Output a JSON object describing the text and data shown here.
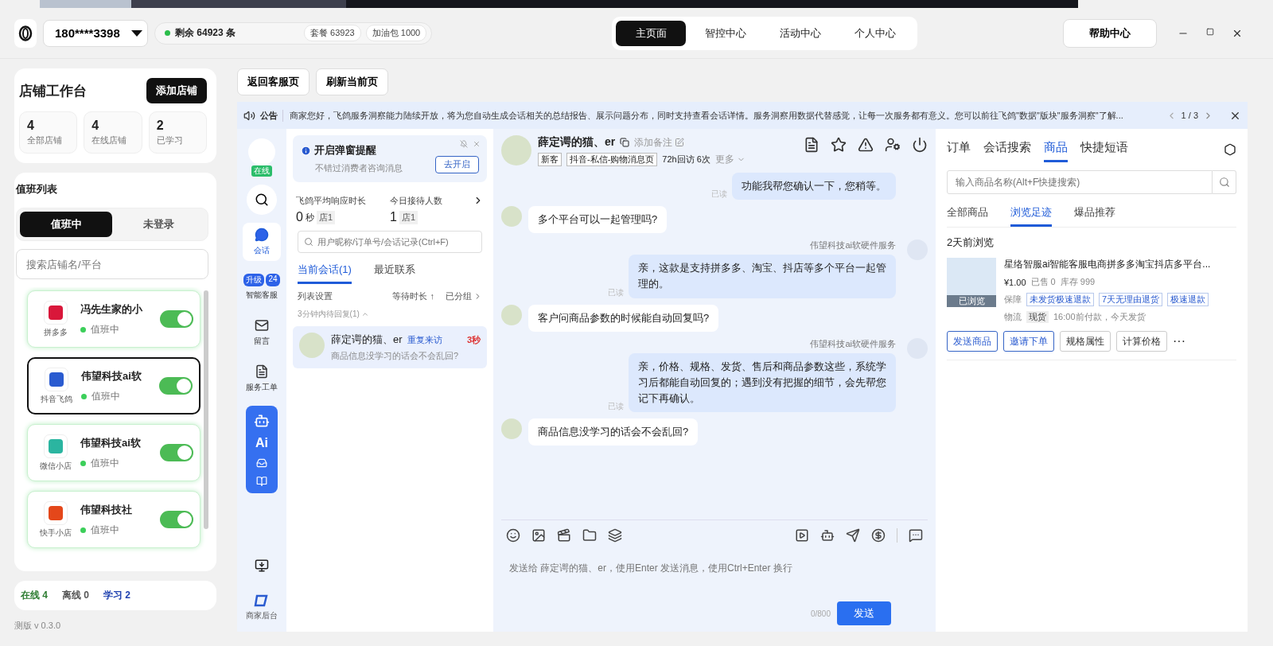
{
  "top_bar": {
    "account": "180****3398",
    "remaining": "剩余 64923 条",
    "package": "套餐 63923",
    "addon": "加油包 1000",
    "nav": [
      {
        "label": "主页面",
        "selected": true
      },
      {
        "label": "智控中心",
        "selected": false
      },
      {
        "label": "活动中心",
        "selected": false
      },
      {
        "label": "个人中心",
        "selected": false
      }
    ],
    "help": "帮助中心"
  },
  "sidebar": {
    "title": "店铺工作台",
    "add_button": "添加店铺",
    "stats": [
      {
        "value": "4",
        "label": "全部店铺"
      },
      {
        "value": "4",
        "label": "在线店铺"
      },
      {
        "value": "2",
        "label": "已学习"
      }
    ],
    "duty_title": "值班列表",
    "segments": [
      {
        "label": "值班中",
        "selected": true
      },
      {
        "label": "未登录",
        "selected": false
      }
    ],
    "search_placeholder": "搜索店铺名/平台",
    "shops": [
      {
        "name": "冯先生家的小",
        "platform": "拼多多",
        "kind": "pdd",
        "status": "值班中",
        "on": true,
        "selected": false
      },
      {
        "name": "伟望科技ai软",
        "platform": "抖音飞鸽",
        "kind": "douyin",
        "status": "值班中",
        "on": true,
        "selected": true
      },
      {
        "name": "伟望科技ai软",
        "platform": "微信小店",
        "kind": "wechat",
        "status": "值班中",
        "on": true,
        "selected": false
      },
      {
        "name": "伟望科技社",
        "platform": "快手小店",
        "kind": "kuaishou",
        "status": "值班中",
        "on": true,
        "selected": false
      }
    ],
    "footer": [
      {
        "label": "在线 4",
        "color": "#2e7d32"
      },
      {
        "label": "离线 0",
        "color": "#555555"
      },
      {
        "label": "学习 2",
        "color": "#1e40af"
      }
    ],
    "version": "测版 v 0.3.0"
  },
  "toolbar": [
    "返回客服页",
    "刷新当前页"
  ],
  "notice": {
    "label": "公告",
    "text": "商家您好，飞鸽服务洞察能力陆续开放，将为您自动生成会话相关的总结报告、展示问题分布，同时支持查看会话详情。服务洞察用数据代替感觉，让每一次服务都有意义。您可以前往飞鸽\"数据\"版块\"服务洞察\"了解...",
    "pager": "1 / 3"
  },
  "rail": {
    "status": "在线",
    "ai_label": "Ai",
    "items": [
      {
        "label": "会话",
        "kind": "chat",
        "selected": true
      },
      {
        "label": "智能客服",
        "kind": "bot",
        "selected": false,
        "badges": [
          "升级",
          "24"
        ]
      },
      {
        "label": "留言",
        "kind": "mail",
        "selected": false
      },
      {
        "label": "服务工单",
        "kind": "ticket",
        "selected": false
      }
    ],
    "bottom": "商家后台"
  },
  "conversations": {
    "reminder": {
      "title": "开启弹窗提醒",
      "subtitle": "不错过消费者咨询消息",
      "button": "去开启"
    },
    "metrics": [
      {
        "label": "飞鸽平均响应时长",
        "value": "0",
        "unit": "秒",
        "tag": "店1"
      },
      {
        "label": "今日接待人数",
        "value": "1",
        "tag": "店1"
      }
    ],
    "search_placeholder": "用户昵称/订单号/会话记录(Ctrl+F)",
    "tabs": [
      {
        "label": "当前会话(1)",
        "selected": true
      },
      {
        "label": "最近联系",
        "selected": false
      }
    ],
    "list_settings": "列表设置",
    "sort": "等待时长 ↑",
    "grouped": "已分组",
    "group": "3分钟内待回复(1)",
    "items": [
      {
        "name": "薛定谔的猫、er",
        "tag": "重复来访",
        "time": "3秒",
        "preview": "商品信息没学习的话会不会乱回?",
        "selected": true
      }
    ]
  },
  "chat": {
    "name": "薛定谔的猫、er",
    "remark": "添加备注",
    "tags": [
      "新客",
      "抖音-私信-购物消息页"
    ],
    "revisit": "72h回访 6次",
    "more": "更多",
    "messages": [
      {
        "kind": "agent",
        "text": "功能我帮您确认一下，您稍等。",
        "read": "已读"
      },
      {
        "kind": "customer",
        "text": "多个平台可以一起管理吗?"
      },
      {
        "kind": "agent",
        "sender": "伟望科技ai软硬件服务",
        "text": "亲，这款是支持拼多多、淘宝、抖店等多个平台一起管理的。",
        "read": "已读"
      },
      {
        "kind": "customer",
        "text": "客户问商品参数的时候能自动回复吗?"
      },
      {
        "kind": "agent",
        "sender": "伟望科技ai软硬件服务",
        "text": "亲，价格、规格、发货、售后和商品参数这些，系统学习后都能自动回复的；遇到没有把握的细节，会先帮您记下再确认。",
        "read": "已读"
      },
      {
        "kind": "customer",
        "text": "商品信息没学习的话会不会乱回?"
      }
    ],
    "input_placeholder": "发送给 薛定谔的猫、er，使用Enter 发送消息，使用Ctrl+Enter 换行",
    "counter": "0/800",
    "send": "发送"
  },
  "products": {
    "tabs": [
      {
        "label": "订单",
        "selected": false
      },
      {
        "label": "会话搜索",
        "selected": false
      },
      {
        "label": "商品",
        "selected": true
      },
      {
        "label": "快捷短语",
        "selected": false
      }
    ],
    "search_placeholder": "输入商品名称(Alt+F快捷搜索)",
    "subtabs": [
      {
        "label": "全部商品",
        "selected": false
      },
      {
        "label": "浏览足迹",
        "selected": true
      },
      {
        "label": "爆品推荐",
        "selected": false
      }
    ],
    "section": "2天前浏览",
    "item": {
      "image_badge": "已浏览",
      "title": "星络智服ai智能客服电商拼多多淘宝抖店多平台...",
      "price": "¥1.00",
      "sold": "已售 0",
      "stock": "库存 999",
      "guarantee_label": "保障",
      "guarantees": [
        "未发货极速退款",
        "7天无理由退货",
        "极速退款"
      ],
      "logistics_label": "物流",
      "logistics_tag": "现货",
      "logistics_text": "16:00前付款，今天发货",
      "actions": [
        {
          "label": "发送商品",
          "kind": "primary"
        },
        {
          "label": "邀请下单",
          "kind": "primary"
        },
        {
          "label": "规格属性",
          "kind": "plain"
        },
        {
          "label": "计算价格",
          "kind": "plain"
        }
      ],
      "more": "···"
    }
  }
}
